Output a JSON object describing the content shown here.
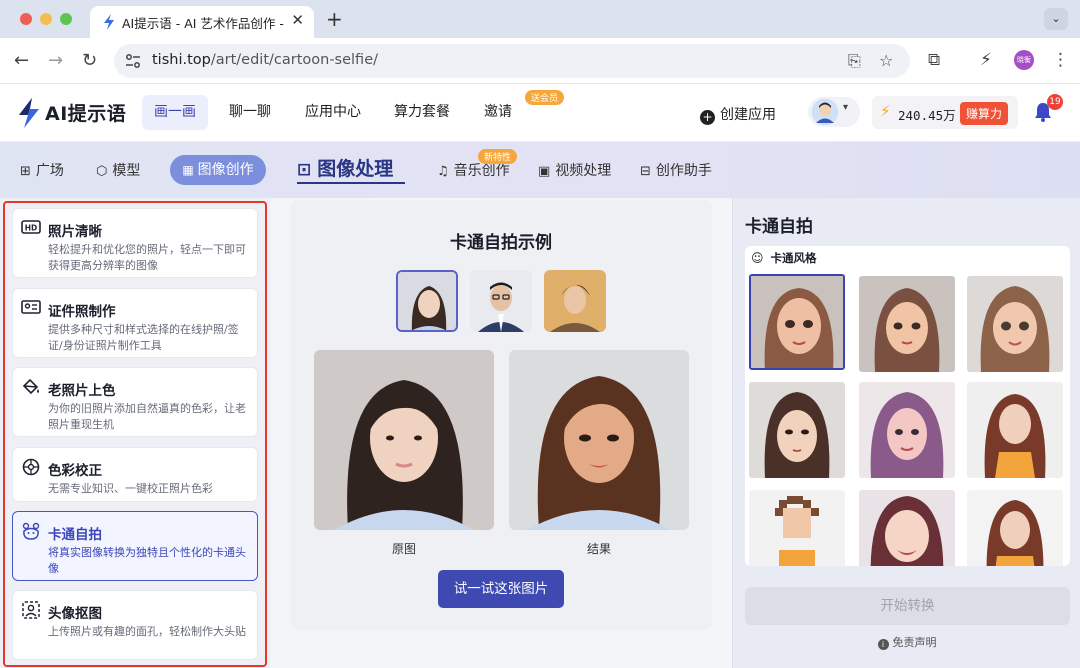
{
  "browser": {
    "tab_title": "AI提示语 - AI 艺术作品创作 - ",
    "tab_close": "✕",
    "new_tab": "+",
    "tab_menu": "⌄",
    "url_host": "tishi.top",
    "url_path": "/art/edit/cartoon-selfie/",
    "profile_label": "晓衡",
    "icons": [
      "back-arrow-icon",
      "forward-arrow-icon",
      "reload-icon",
      "site-settings-icon",
      "install-app-icon",
      "bookmark-star-icon",
      "extensions-icon",
      "performance-icon",
      "kebab-menu-icon"
    ]
  },
  "header": {
    "logo_text": "AI提示语",
    "nav": [
      {
        "label": "画一画",
        "active": true
      },
      {
        "label": "聊一聊"
      },
      {
        "label": "应用中心"
      },
      {
        "label": "算力套餐"
      },
      {
        "label": "邀请"
      }
    ],
    "invite_badge": "送会员",
    "create_app": "创建应用",
    "credits": "240.45万",
    "earn_label": "赚算力",
    "notification_count": "19",
    "colors": {
      "accent": "#3c45b5",
      "earn": "#ef5236",
      "badge": "#f7a63a"
    }
  },
  "subnav": {
    "items": [
      {
        "icon": "grid-icon",
        "glyph": "⊞",
        "label": "广场"
      },
      {
        "icon": "cube-icon",
        "glyph": "⬡",
        "label": "模型"
      },
      {
        "icon": "image-create-icon",
        "glyph": "▦",
        "label": "图像创作"
      },
      {
        "icon": "image-process-icon",
        "glyph": "⊡",
        "label": "图像处理"
      },
      {
        "icon": "music-icon",
        "glyph": "♫",
        "label": "音乐创作"
      },
      {
        "icon": "video-icon",
        "glyph": "▣",
        "label": "视频处理"
      },
      {
        "icon": "assistant-icon",
        "glyph": "⊟",
        "label": "创作助手"
      }
    ],
    "new_badge": "新特性"
  },
  "sidebar": {
    "tools": [
      {
        "icon": "hd-icon",
        "glyph": "HD",
        "title": "照片清晰",
        "desc": "轻松提升和优化您的照片，轻点一下即可获得更高分辨率的图像"
      },
      {
        "icon": "id-card-icon",
        "glyph": "▤",
        "title": "证件照制作",
        "desc": "提供多种尺寸和样式选择的在线护照/签证/身份证照片制作工具"
      },
      {
        "icon": "paint-bucket-icon",
        "glyph": "◈",
        "title": "老照片上色",
        "desc": "为你的旧照片添加自然逼真的色彩，让老照片重现生机"
      },
      {
        "icon": "color-wheel-icon",
        "glyph": "✲",
        "title": "色彩校正",
        "desc": "无需专业知识、一键校正照片色彩"
      },
      {
        "icon": "cartoon-face-icon",
        "glyph": "☺",
        "title": "卡通自拍",
        "desc": "将真实图像转换为独特且个性化的卡通头像",
        "active": true
      },
      {
        "icon": "portrait-cutout-icon",
        "glyph": "⊡",
        "title": "头像抠图",
        "desc": "上传照片或有趣的面孔，轻松制作大头贴"
      }
    ]
  },
  "center": {
    "title": "卡通自拍示例",
    "original_caption": "原图",
    "result_caption": "结果",
    "try_button": "试一试这张图片"
  },
  "right": {
    "title": "卡通自拍",
    "style_label": "卡通风格",
    "start_button": "开始转换",
    "disclaimer": "免责声明"
  }
}
